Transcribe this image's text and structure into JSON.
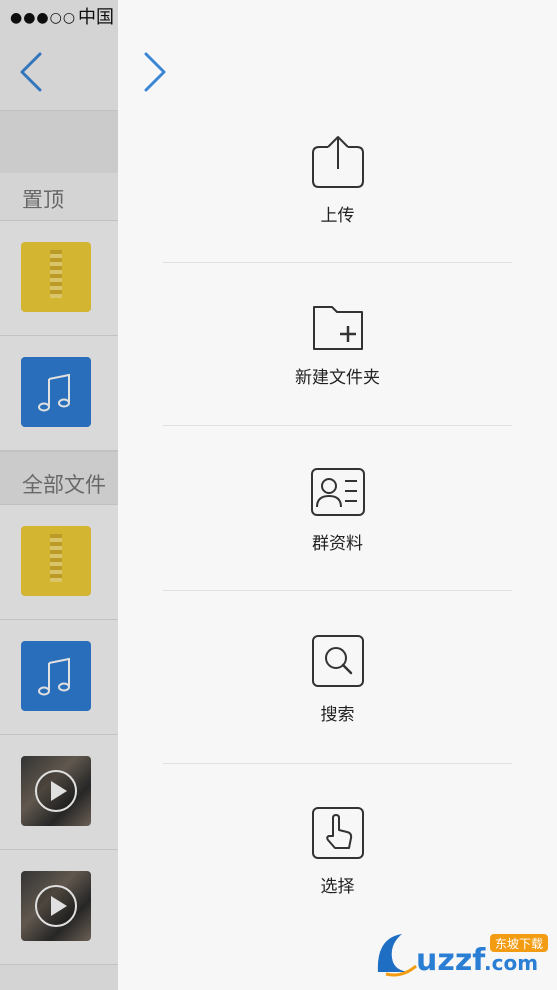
{
  "status_bar": {
    "signal": "●●●○○",
    "carrier": "中国"
  },
  "background_list": {
    "pinned_label": "置顶",
    "all_files_label": "全部文件",
    "pinned_files": [
      {
        "type": "zip"
      },
      {
        "type": "music"
      }
    ],
    "all_files": [
      {
        "type": "zip"
      },
      {
        "type": "music"
      },
      {
        "type": "video"
      },
      {
        "type": "video"
      }
    ]
  },
  "menu": {
    "items": [
      {
        "id": "upload",
        "label": "上传",
        "icon": "upload-icon"
      },
      {
        "id": "new-folder",
        "label": "新建文件夹",
        "icon": "new-folder-icon"
      },
      {
        "id": "group-info",
        "label": "群资料",
        "icon": "contact-card-icon"
      },
      {
        "id": "search",
        "label": "搜索",
        "icon": "search-icon"
      },
      {
        "id": "select",
        "label": "选择",
        "icon": "hand-pointer-icon"
      }
    ]
  },
  "watermark": {
    "brand": "uzzf.com",
    "tag": "东坡下载"
  },
  "colors": {
    "accent": "#3a86d6",
    "zip": "#f1ce3a",
    "music": "#2f7ed4",
    "icon_stroke": "#333333"
  }
}
